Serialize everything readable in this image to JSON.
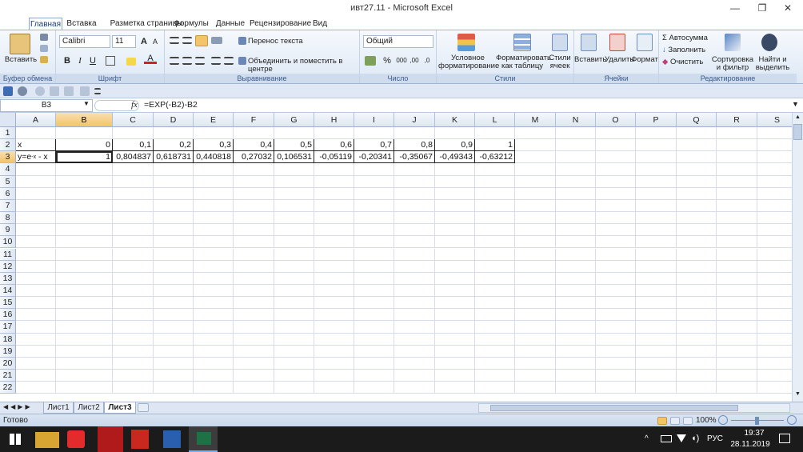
{
  "window": {
    "title": "ивт27.11 - Microsoft Excel"
  },
  "window_controls": {
    "minimize": "—",
    "restore": "❐",
    "close": "✕"
  },
  "tabs": [
    "Главная",
    "Вставка",
    "Разметка страницы",
    "Формулы",
    "Данные",
    "Рецензирование",
    "Вид"
  ],
  "ribbon": {
    "clipboard": {
      "paste": "Вставить",
      "label": "Буфер обмена"
    },
    "font": {
      "name": "Calibri",
      "size": "11",
      "label": "Шрифт",
      "bold": "B",
      "italic": "I",
      "underline": "U",
      "grow": "A",
      "shrink": "A",
      "color": "A"
    },
    "alignment": {
      "wrap": "Перенос текста",
      "merge": "Объединить и поместить в центре",
      "label": "Выравнивание"
    },
    "number": {
      "format": "Общий",
      "percent": "%",
      "comma": "000",
      "inc_decimal": ",00",
      "dec_decimal": ",0",
      "label": "Число"
    },
    "styles": {
      "conditional_1": "Условное",
      "conditional_2": "форматирование",
      "table_1": "Форматировать",
      "table_2": "как таблицу",
      "cell_1": "Стили",
      "cell_2": "ячеек",
      "label": "Стили"
    },
    "cells": {
      "insert": "Вставить",
      "delete": "Удалить",
      "format": "Формат",
      "label": "Ячейки"
    },
    "editing": {
      "autosum": "Автосумма",
      "fill": "Заполнить",
      "clear": "Очистить",
      "sort_1": "Сортировка",
      "sort_2": "и фильтр",
      "find_1": "Найти и",
      "find_2": "выделить",
      "label": "Редактирование"
    }
  },
  "formula_bar": {
    "name_box": "B3",
    "fx": "fx",
    "formula": "=EXP(-B2)-B2"
  },
  "columns": [
    "A",
    "B",
    "C",
    "D",
    "E",
    "F",
    "G",
    "H",
    "I",
    "J",
    "K",
    "L",
    "M",
    "N",
    "O",
    "P",
    "Q",
    "R",
    "S"
  ],
  "rows": [
    "1",
    "2",
    "3",
    "4",
    "5",
    "6",
    "7",
    "8",
    "9",
    "10",
    "11",
    "12",
    "13",
    "14",
    "15",
    "16",
    "17",
    "18",
    "19",
    "20",
    "21",
    "22"
  ],
  "sheet": {
    "row2": {
      "A": "x",
      "values": [
        "0",
        "0,1",
        "0,2",
        "0,3",
        "0,4",
        "0,5",
        "0,6",
        "0,7",
        "0,8",
        "0,9",
        "1"
      ]
    },
    "row3": {
      "A_base": "y=e",
      "A_sup": "-x",
      "A_tail": " - x",
      "values": [
        "1",
        "0,804837",
        "0,618731",
        "0,440818",
        "0,27032",
        "0,106531",
        "-0,05119",
        "-0,20341",
        "-0,35067",
        "-0,49343",
        "-0,63212"
      ]
    }
  },
  "sheet_tabs": [
    "Лист1",
    "Лист2",
    "Лист3"
  ],
  "active_sheet": "Лист3",
  "status": {
    "ready": "Готово",
    "zoom": "100%"
  },
  "taskbar": {
    "lang": "РУС",
    "time": "19:37",
    "date": "28.11.2019"
  },
  "colors": {
    "accent": "#1c3f7a",
    "selection": "#f3c46a",
    "taskbar": "#1b1b1b"
  }
}
